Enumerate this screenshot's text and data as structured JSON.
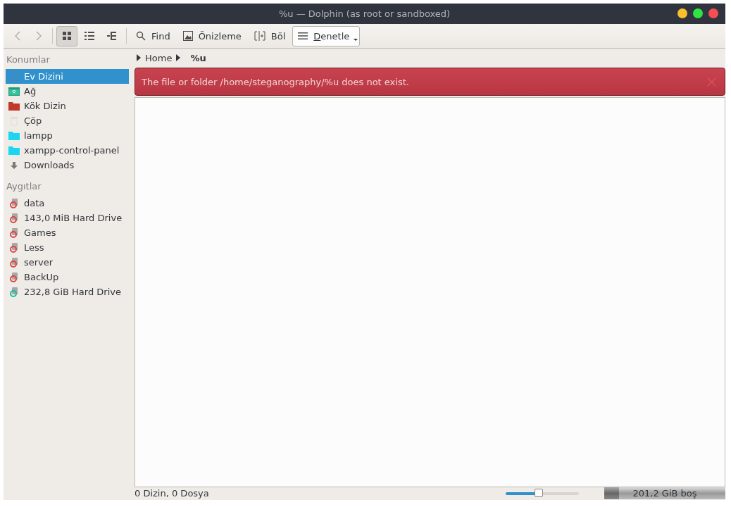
{
  "window": {
    "title": "%u — Dolphin (as root or sandboxed)"
  },
  "toolbar": {
    "back": {
      "disabled": true
    },
    "forward": {
      "disabled": true
    },
    "view_modes": [
      {
        "kind": "icons",
        "selected": true
      },
      {
        "kind": "details",
        "selected": false
      },
      {
        "kind": "tree",
        "selected": false
      }
    ],
    "actions": [
      {
        "kind": "search",
        "label": "Find"
      },
      {
        "kind": "preview",
        "label": "Önizleme"
      },
      {
        "kind": "split",
        "label": "Böl"
      }
    ],
    "menu_button": {
      "label": "Denetle"
    }
  },
  "sidebar": {
    "sections": [
      {
        "title": "Konumlar",
        "items": [
          {
            "kind": "home",
            "label": "Ev Dizini",
            "selected": true
          },
          {
            "kind": "network",
            "label": "Ağ",
            "selected": false
          },
          {
            "kind": "root",
            "label": "Kök Dizin",
            "selected": false
          },
          {
            "kind": "trash",
            "label": "Çöp",
            "selected": false
          },
          {
            "kind": "folder",
            "label": "lampp",
            "selected": false
          },
          {
            "kind": "folder",
            "label": "xampp-control-panel",
            "selected": false
          },
          {
            "kind": "download",
            "label": "Downloads",
            "selected": false
          }
        ]
      },
      {
        "title": "Aygıtlar",
        "items": [
          {
            "kind": "drive",
            "color": "#e0443e",
            "label": "data",
            "selected": false
          },
          {
            "kind": "drive",
            "color": "#e0443e",
            "label": "143,0 MiB Hard Drive",
            "selected": false
          },
          {
            "kind": "drive",
            "color": "#e0443e",
            "label": "Games",
            "selected": false
          },
          {
            "kind": "drive",
            "color": "#e0443e",
            "label": "Less",
            "selected": false
          },
          {
            "kind": "drive",
            "color": "#e0443e",
            "label": "server",
            "selected": false
          },
          {
            "kind": "drive",
            "color": "#e0443e",
            "label": "BackUp",
            "selected": false
          },
          {
            "kind": "drive",
            "color": "#1abc9c",
            "label": "232,8 GiB Hard Drive",
            "selected": false
          }
        ]
      }
    ]
  },
  "breadcrumb": [
    "Home",
    "%u"
  ],
  "error": {
    "message": "The file or folder /home/steganography/%u does not exist."
  },
  "status_bar": {
    "summary": "0 Dizin, 0 Dosya",
    "zoom": {
      "level": 0.45
    },
    "free_space": {
      "label": "201,2 GiB boş",
      "level": 0.12
    }
  }
}
